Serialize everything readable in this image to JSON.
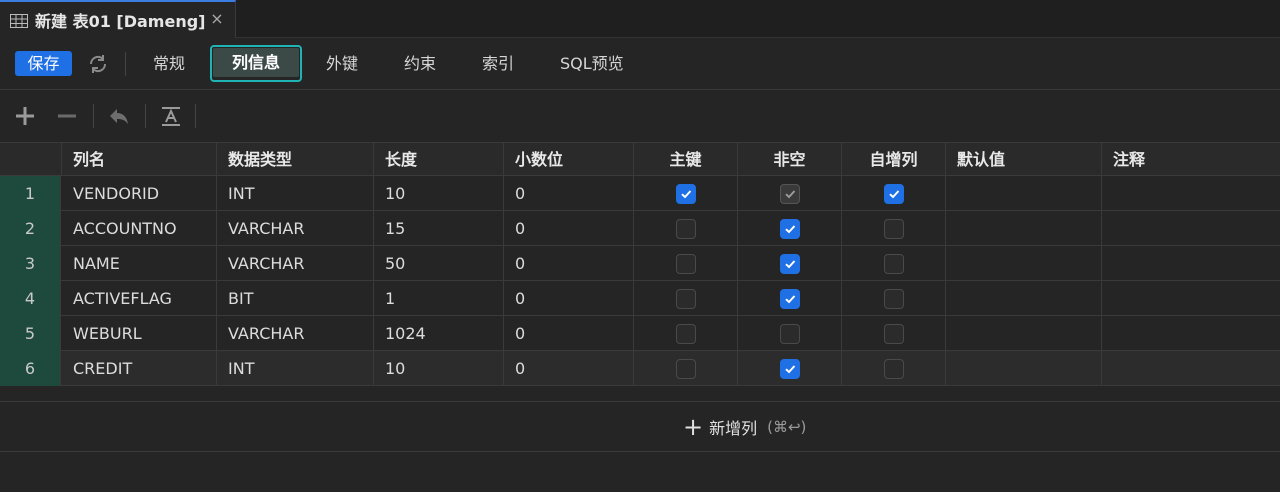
{
  "tab": {
    "title": "新建 表01 [Dameng]",
    "close": "×"
  },
  "toolbar": {
    "save_label": "保存",
    "tabs": [
      "常规",
      "列信息",
      "外键",
      "约束",
      "索引",
      "SQL预览"
    ],
    "active_tab": "列信息"
  },
  "grid": {
    "headers": [
      "列名",
      "数据类型",
      "长度",
      "小数位",
      "主键",
      "非空",
      "自增列",
      "默认值",
      "注释"
    ],
    "rows": [
      {
        "num": "1",
        "name": "VENDORID",
        "type": "INT",
        "length": "10",
        "scale": "0",
        "pk": "on",
        "notnull": "dim",
        "autoinc": "on",
        "default": "",
        "comment": ""
      },
      {
        "num": "2",
        "name": "ACCOUNTNO",
        "type": "VARCHAR",
        "length": "15",
        "scale": "0",
        "pk": "off",
        "notnull": "on",
        "autoinc": "off",
        "default": "",
        "comment": ""
      },
      {
        "num": "3",
        "name": "NAME",
        "type": "VARCHAR",
        "length": "50",
        "scale": "0",
        "pk": "off",
        "notnull": "on",
        "autoinc": "off",
        "default": "",
        "comment": ""
      },
      {
        "num": "4",
        "name": "ACTIVEFLAG",
        "type": "BIT",
        "length": "1",
        "scale": "0",
        "pk": "off",
        "notnull": "on",
        "autoinc": "off",
        "default": "",
        "comment": ""
      },
      {
        "num": "5",
        "name": "WEBURL",
        "type": "VARCHAR",
        "length": "1024",
        "scale": "0",
        "pk": "off",
        "notnull": "off",
        "autoinc": "off",
        "default": "",
        "comment": ""
      },
      {
        "num": "6",
        "name": "CREDIT",
        "type": "INT",
        "length": "10",
        "scale": "0",
        "pk": "off",
        "notnull": "on",
        "autoinc": "off",
        "default": "",
        "comment": ""
      }
    ]
  },
  "footer": {
    "add_label": "新增列",
    "shortcut": "(⌘↩)"
  },
  "colors": {
    "accent": "#1f6fe5",
    "active_border": "#1fb3b3",
    "rownum_bg": "#1e4a3e"
  }
}
